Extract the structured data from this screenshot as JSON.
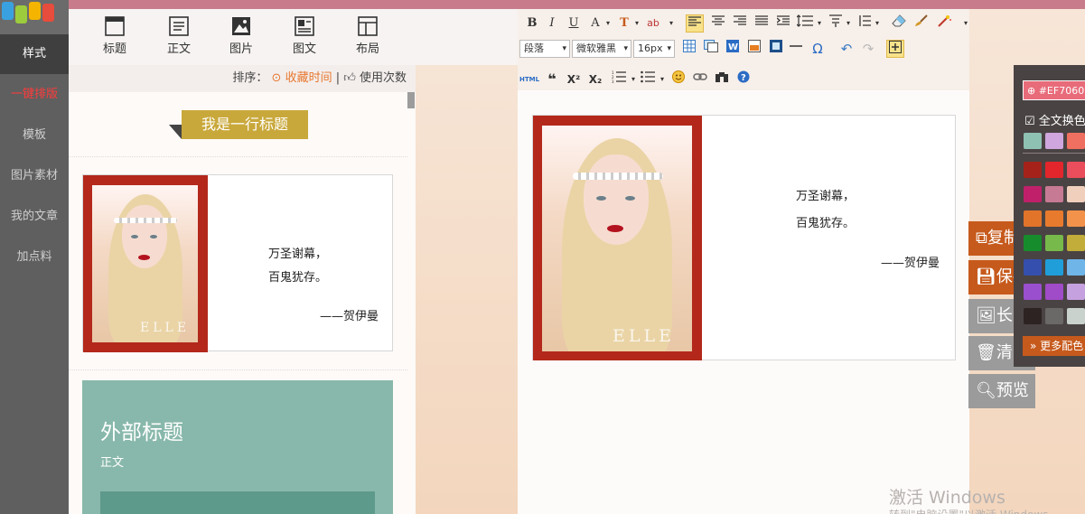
{
  "left_nav": {
    "items": [
      {
        "label": "样式",
        "state": "active"
      },
      {
        "label": "一键排版",
        "state": "hot"
      },
      {
        "label": "模板",
        "state": ""
      },
      {
        "label": "图片素材",
        "state": ""
      },
      {
        "label": "我的文章",
        "state": ""
      },
      {
        "label": "加点料",
        "state": ""
      }
    ]
  },
  "style_tools": [
    {
      "label": "标题",
      "icon": "title-icon"
    },
    {
      "label": "正文",
      "icon": "text-icon"
    },
    {
      "label": "图片",
      "icon": "image-icon"
    },
    {
      "label": "图文",
      "icon": "image-text-icon"
    },
    {
      "label": "布局",
      "icon": "layout-icon"
    }
  ],
  "sort_bar": {
    "prefix": "排序：",
    "option_favorite": "收藏时间",
    "separator": "|",
    "option_usage": "使用次数"
  },
  "templates": {
    "title_block": "我是一行标题",
    "quote": {
      "line1": "万圣谢幕，",
      "line2": "百鬼犹存。",
      "author": "——贺伊曼"
    },
    "photo_watermark": "ELLE",
    "green_card": {
      "heading": "外部标题",
      "body": "正文"
    }
  },
  "toolbar": {
    "row1": [
      "B",
      "I",
      "U",
      "A",
      "T",
      "ab"
    ],
    "paragraph_select": "段落",
    "font_select": "微软雅黑",
    "size_select": "16px",
    "row3_html": "HTML",
    "row3_quote": "❝",
    "row3_sup": "X²",
    "row3_sub": "X₂"
  },
  "document": {
    "quote": {
      "line1": "万圣谢幕，",
      "line2": "百鬼犹存。",
      "author": "——贺伊曼"
    },
    "photo_watermark": "ELLE"
  },
  "side_buttons": [
    {
      "label": "复制",
      "icon": "copy-icon",
      "style": "orange"
    },
    {
      "label": "保存",
      "icon": "save-icon",
      "style": "orange"
    },
    {
      "label": "长图",
      "icon": "long-image-icon",
      "style": "gray"
    },
    {
      "label": "清空",
      "icon": "trash-icon",
      "style": "gray"
    },
    {
      "label": "预览",
      "icon": "search-icon",
      "style": "gray"
    }
  ],
  "color_panel": {
    "hex_value": "#EF7060",
    "full_text_label": "全文换色",
    "more_label": "更多配色",
    "swatches_top": [
      "#8fc1b3",
      "#cfa6dd",
      "#ef7060"
    ],
    "swatches": [
      [
        "#a5221a",
        "#e3262b",
        "#ea4d5b"
      ],
      [
        "#c0206a",
        "#c77a94",
        "#f0d0bd"
      ],
      [
        "#e2742a",
        "#e87a2e",
        "#f3924b"
      ],
      [
        "#178c2c",
        "#77b94a",
        "#c2ad3a"
      ],
      [
        "#344fae",
        "#1f9ed9",
        "#6fb5e8"
      ],
      [
        "#9a4fcf",
        "#a04bc7",
        "#c6a1e0"
      ],
      [
        "#2d2323",
        "#6b6868",
        "#c9d2cd"
      ]
    ]
  },
  "os_watermark": {
    "line1": "激活 Windows",
    "line2": "转到\"电脑设置\"以激活 Windows。"
  }
}
